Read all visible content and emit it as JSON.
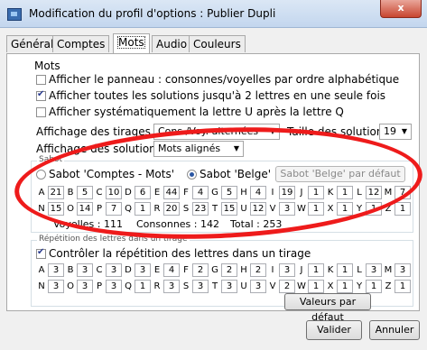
{
  "window": {
    "title": "Modification du profil d'options : Publier Dupli",
    "close_label": "x"
  },
  "tabs": [
    {
      "label": "Général",
      "active": false
    },
    {
      "label": "Comptes",
      "active": false
    },
    {
      "label": "Mots",
      "active": true
    },
    {
      "label": "Audio",
      "active": false
    },
    {
      "label": "Couleurs",
      "active": false
    }
  ],
  "mots": {
    "section_title": "Mots",
    "options": [
      {
        "label": "Afficher le panneau : consonnes/voyelles par ordre alphabétique",
        "checked": false
      },
      {
        "label": "Afficher toutes les solutions jusqu'à 2 lettres en une seule fois",
        "checked": true
      },
      {
        "label": "Afficher systématiquement la lettre U après la lettre Q",
        "checked": false
      }
    ],
    "tirages_label": "Affichage des tirages",
    "tirages_value": "Cons./Voy. alternées",
    "taille_label": "Taille des solutions",
    "taille_value": "19",
    "solutions_label": "Affichage des solutions",
    "solutions_value": "Mots alignés"
  },
  "sabot": {
    "title": "Sabot",
    "radio_comptes": "Sabot 'Comptes - Mots'",
    "radio_belge": "Sabot 'Belge'",
    "default_button": "Sabot 'Belge' par défaut",
    "row1": [
      {
        "letter": "A",
        "value": "21"
      },
      {
        "letter": "B",
        "value": "5"
      },
      {
        "letter": "C",
        "value": "10"
      },
      {
        "letter": "D",
        "value": "6"
      },
      {
        "letter": "E",
        "value": "44"
      },
      {
        "letter": "F",
        "value": "4"
      },
      {
        "letter": "G",
        "value": "5"
      },
      {
        "letter": "H",
        "value": "4"
      },
      {
        "letter": "I",
        "value": "19"
      },
      {
        "letter": "J",
        "value": "1"
      },
      {
        "letter": "K",
        "value": "1"
      },
      {
        "letter": "L",
        "value": "12"
      },
      {
        "letter": "M",
        "value": "7"
      }
    ],
    "row2": [
      {
        "letter": "N",
        "value": "15"
      },
      {
        "letter": "O",
        "value": "14"
      },
      {
        "letter": "P",
        "value": "7"
      },
      {
        "letter": "Q",
        "value": "1"
      },
      {
        "letter": "R",
        "value": "20"
      },
      {
        "letter": "S",
        "value": "23"
      },
      {
        "letter": "T",
        "value": "15"
      },
      {
        "letter": "U",
        "value": "12"
      },
      {
        "letter": "V",
        "value": "3"
      },
      {
        "letter": "W",
        "value": "1"
      },
      {
        "letter": "X",
        "value": "1"
      },
      {
        "letter": "Y",
        "value": "1"
      },
      {
        "letter": "Z",
        "value": "1"
      }
    ],
    "voyelles": "Voyelles : 111",
    "consonnes": "Consonnes : 142",
    "total": "Total : 253"
  },
  "repetition": {
    "title": "Répétition des lettres dans un tirage",
    "check_label": "Contrôler la répétition des lettres dans un tirage",
    "checked": true,
    "row1": [
      {
        "letter": "A",
        "value": "3"
      },
      {
        "letter": "B",
        "value": "3"
      },
      {
        "letter": "C",
        "value": "3"
      },
      {
        "letter": "D",
        "value": "3"
      },
      {
        "letter": "E",
        "value": "4"
      },
      {
        "letter": "F",
        "value": "2"
      },
      {
        "letter": "G",
        "value": "2"
      },
      {
        "letter": "H",
        "value": "2"
      },
      {
        "letter": "I",
        "value": "3"
      },
      {
        "letter": "J",
        "value": "1"
      },
      {
        "letter": "K",
        "value": "1"
      },
      {
        "letter": "L",
        "value": "3"
      },
      {
        "letter": "M",
        "value": "3"
      }
    ],
    "row2": [
      {
        "letter": "N",
        "value": "3"
      },
      {
        "letter": "O",
        "value": "3"
      },
      {
        "letter": "P",
        "value": "3"
      },
      {
        "letter": "Q",
        "value": "1"
      },
      {
        "letter": "R",
        "value": "3"
      },
      {
        "letter": "S",
        "value": "3"
      },
      {
        "letter": "T",
        "value": "3"
      },
      {
        "letter": "U",
        "value": "3"
      },
      {
        "letter": "V",
        "value": "2"
      },
      {
        "letter": "W",
        "value": "1"
      },
      {
        "letter": "X",
        "value": "1"
      },
      {
        "letter": "Y",
        "value": "1"
      },
      {
        "letter": "Z",
        "value": "1"
      }
    ],
    "default_button": "Valeurs par défaut"
  },
  "footer": {
    "validate": "Valider",
    "cancel": "Annuler"
  },
  "colors": {
    "highlight_ring": "#ee1b1b",
    "accent_check": "#2a3b8f"
  }
}
